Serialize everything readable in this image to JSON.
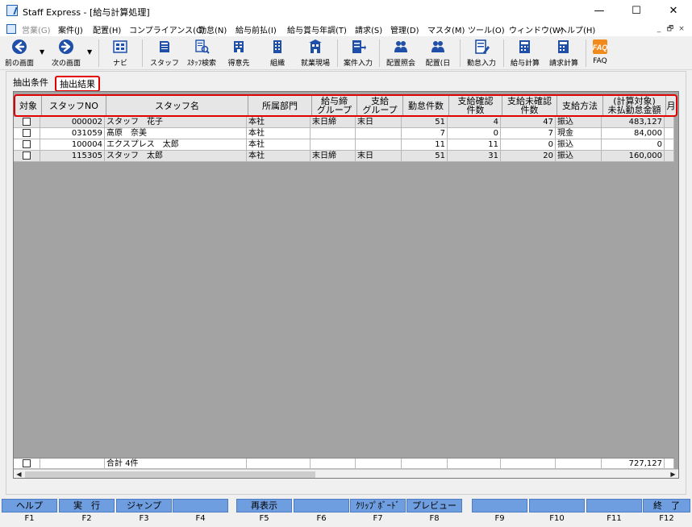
{
  "window": {
    "title": "Staff Express - [給与計算処理]",
    "minimize_glyph": "—",
    "maximize_glyph": "☐",
    "close_glyph": "✕"
  },
  "menu": {
    "items": [
      {
        "label": "営業(G)",
        "disabled": true
      },
      {
        "label": "案件(J)"
      },
      {
        "label": "配置(H)"
      },
      {
        "label": "コンプライアンス(C)"
      },
      {
        "label": "勤怠(N)"
      },
      {
        "label": "給与前払(I)"
      },
      {
        "label": "給与賞与年調(T)"
      },
      {
        "label": "請求(S)"
      },
      {
        "label": "管理(D)"
      },
      {
        "label": "マスタ(M)"
      },
      {
        "label": "ツール(O)"
      },
      {
        "label": "ウィンドウ(W)"
      },
      {
        "label": "ヘルプ(H)"
      }
    ],
    "mdi_min": "_",
    "mdi_restore": "🗗",
    "mdi_close": "×"
  },
  "toolbar": {
    "items": [
      {
        "label": "前の画面",
        "icon": "back-arrow-icon"
      },
      {
        "label": "次の画面",
        "icon": "forward-arrow-icon"
      },
      {
        "label": "ナビ",
        "icon": "navi-icon"
      },
      {
        "label": "スタッフ",
        "icon": "staff-icon"
      },
      {
        "label": "ｽﾀｯﾌ検索",
        "icon": "staff-search-icon"
      },
      {
        "label": "得意先",
        "icon": "client-icon"
      },
      {
        "label": "組織",
        "icon": "organization-icon"
      },
      {
        "label": "就業現場",
        "icon": "worksite-icon"
      },
      {
        "label": "案件入力",
        "icon": "job-entry-icon"
      },
      {
        "label": "配置照会",
        "icon": "placement-inquiry-icon"
      },
      {
        "label": "配置(日",
        "icon": "placement-daily-icon"
      },
      {
        "label": "勤怠入力",
        "icon": "attendance-entry-icon"
      },
      {
        "label": "給与計算",
        "icon": "payroll-calc-icon"
      },
      {
        "label": "請求計算",
        "icon": "billing-calc-icon"
      },
      {
        "label": "FAQ",
        "icon": "faq-icon"
      }
    ]
  },
  "tabs": [
    {
      "label": "抽出条件",
      "active": false
    },
    {
      "label": "抽出結果",
      "active": true
    }
  ],
  "table": {
    "headers": [
      "対象",
      "スタッフNO",
      "スタッフ名",
      "所属部門",
      "給与締\nグループ",
      "支給\nグループ",
      "勤怠件数",
      "支給確認\n件数",
      "支給未確認\n件数",
      "支給方法",
      "(計算対象)\n未払勤怠金額",
      "月"
    ],
    "rows": [
      [
        "",
        "000002",
        "スタッフ　花子",
        "本社",
        "末日締",
        "末日",
        "51",
        "4",
        "47",
        "振込",
        "483,127",
        ""
      ],
      [
        "",
        "031059",
        "髙原　奈美",
        "本社",
        "",
        "",
        "7",
        "0",
        "7",
        "現金",
        "84,000",
        ""
      ],
      [
        "",
        "100004",
        "エクスプレス　太郎",
        "本社",
        "",
        "",
        "11",
        "11",
        "0",
        "振込",
        "0",
        ""
      ],
      [
        "",
        "115305",
        "スタッフ　太郎",
        "本社",
        "末日締",
        "末日",
        "51",
        "31",
        "20",
        "振込",
        "160,000",
        ""
      ]
    ],
    "footer": {
      "total_label": "合計 4件",
      "total_amount": "727,127"
    }
  },
  "fkeys": [
    {
      "label": "ヘルプ",
      "key": "F1"
    },
    {
      "label": "実　行",
      "key": "F2"
    },
    {
      "label": "ジャンプ",
      "key": "F3"
    },
    {
      "label": "",
      "key": "F4"
    },
    {
      "label": "再表示",
      "key": "F5"
    },
    {
      "label": "",
      "key": "F6"
    },
    {
      "label": "ｸﾘｯﾌﾟﾎﾞｰﾄﾞ",
      "key": "F7"
    },
    {
      "label": "プレビュー",
      "key": "F8"
    },
    {
      "label": "",
      "key": "F9"
    },
    {
      "label": "",
      "key": "F10"
    },
    {
      "label": "",
      "key": "F11"
    },
    {
      "label": "終　了",
      "key": "F12"
    }
  ],
  "colors": {
    "highlight": "#e00000",
    "fkey_button": "#6f9ee0",
    "grid_background": "#a3a3a3",
    "row_alt": "#e4e4e4",
    "disabled_text": "#8a8a8a"
  }
}
